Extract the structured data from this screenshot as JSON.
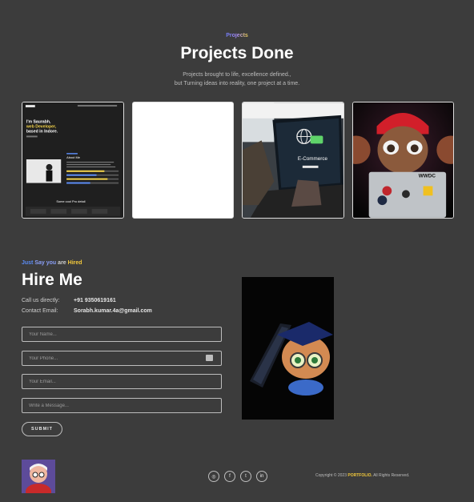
{
  "projects": {
    "eyebrow": "Projects",
    "title": "Projects Done",
    "subtitle_line1": "Projects brought to life, excellence defined.,",
    "subtitle_line2": "but Turning ideas into reality, one project at a time.",
    "card1_text": {
      "line1": "I'm Saurabh,",
      "line2": "web Developer,",
      "line3": "based in Indore.",
      "about": "About Me",
      "bottom": "Some cool Pro detail"
    },
    "card3_text": "E-Commerce",
    "card4_text": "WWDC"
  },
  "hire": {
    "eyebrow_just": "Just",
    "eyebrow_say": "Say you",
    "eyebrow_are": "are",
    "eyebrow_hired": "Hired",
    "title": "Hire Me",
    "call_label": "Call us directly:",
    "call_value": "+91 9350619161",
    "email_label": "Contact Email:",
    "email_value": "Sorabh.kumar.4a@gmail.com",
    "name_placeholder": "Your Name...",
    "phone_placeholder": "Your Phone...",
    "email_placeholder": "Your Email...",
    "message_placeholder": "Write a Message...",
    "submit_label": "SUBMIT"
  },
  "footer": {
    "social": [
      "instagram-icon",
      "facebook-icon",
      "twitter-icon",
      "linkedin-icon"
    ],
    "social_glyphs": [
      "◎",
      "f",
      "t",
      "in"
    ],
    "copyright_prefix": "Copyright © 2023",
    "brand": "PORTFOLIO.",
    "copyright_suffix": "All Rights Reserved."
  },
  "colors": {
    "background": "#3c3c3c",
    "accent_blue": "#5b8cf5",
    "accent_yellow": "#f3c93b"
  }
}
